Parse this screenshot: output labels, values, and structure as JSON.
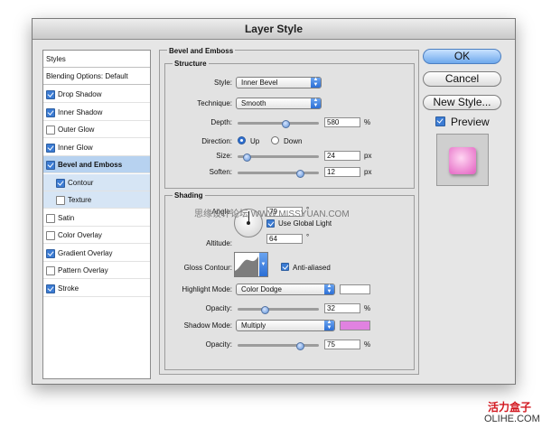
{
  "window": {
    "title": "Layer Style"
  },
  "left_panel": {
    "styles_label": "Styles",
    "blending_label": "Blending Options: Default",
    "items": [
      {
        "label": "Drop Shadow",
        "checked": true
      },
      {
        "label": "Inner Shadow",
        "checked": true
      },
      {
        "label": "Outer Glow",
        "checked": false
      },
      {
        "label": "Inner Glow",
        "checked": true
      },
      {
        "label": "Bevel and Emboss",
        "checked": true,
        "selected": true
      },
      {
        "label": "Contour",
        "checked": true,
        "sub": true
      },
      {
        "label": "Texture",
        "checked": false,
        "sub": true
      },
      {
        "label": "Satin",
        "checked": false
      },
      {
        "label": "Color Overlay",
        "checked": false
      },
      {
        "label": "Gradient Overlay",
        "checked": true
      },
      {
        "label": "Pattern Overlay",
        "checked": false
      },
      {
        "label": "Stroke",
        "checked": true
      }
    ]
  },
  "bevel": {
    "section_title": "Bevel and Emboss",
    "structure_title": "Structure",
    "style_label": "Style:",
    "style_value": "Inner Bevel",
    "technique_label": "Technique:",
    "technique_value": "Smooth",
    "depth_label": "Depth:",
    "depth_value": "580",
    "depth_unit": "%",
    "depth_fraction": 0.58,
    "direction_label": "Direction:",
    "up_label": "Up",
    "down_label": "Down",
    "size_label": "Size:",
    "size_value": "24",
    "size_unit": "px",
    "size_fraction": 0.1,
    "soften_label": "Soften:",
    "soften_value": "12",
    "soften_unit": "px",
    "soften_fraction": 0.75
  },
  "shading": {
    "title": "Shading",
    "angle_label": "Angle:",
    "angle_value": "79",
    "angle_unit": "°",
    "global_light_label": "Use Global Light",
    "altitude_label": "Altitude:",
    "altitude_value": "64",
    "altitude_unit": "°",
    "gloss_label": "Gloss Contour:",
    "anti_aliased_label": "Anti-aliased",
    "highlight_label": "Highlight Mode:",
    "highlight_value": "Color Dodge",
    "highlight_color": "#ffffff",
    "highlight_opacity_label": "Opacity:",
    "highlight_opacity": "32",
    "highlight_opacity_unit": "%",
    "highlight_fraction": 0.32,
    "shadow_label": "Shadow Mode:",
    "shadow_value": "Multiply",
    "shadow_color": "#e082e0",
    "shadow_opacity_label": "Opacity:",
    "shadow_opacity": "75",
    "shadow_opacity_unit": "%",
    "shadow_fraction": 0.75
  },
  "buttons": {
    "ok": "OK",
    "cancel": "Cancel",
    "new_style": "New Style...",
    "preview_label": "Preview"
  },
  "watermarks": {
    "site_overlay": "思缘设计论坛 WWW.MISSYUAN.COM",
    "brand_cn": "活力盒子",
    "brand_en": "OLIHE.COM"
  }
}
